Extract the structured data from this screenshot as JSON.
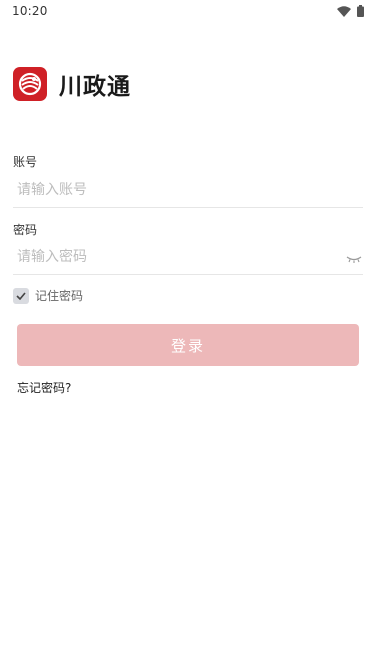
{
  "status_bar": {
    "time": "10:20",
    "icons": [
      "wifi-icon",
      "battery-icon"
    ]
  },
  "brand": {
    "app_name": "川政通",
    "logo_icon": "app-logo-icon",
    "logo_color": "#cf2026"
  },
  "login_form": {
    "account": {
      "label": "账号",
      "placeholder": "请输入账号",
      "value": ""
    },
    "password": {
      "label": "密码",
      "placeholder": "请输入密码",
      "value": "",
      "toggle_icon": "eye-closed-icon"
    },
    "remember": {
      "label": "记住密码",
      "checked": true
    },
    "login_button_label": "登录",
    "forgot_password_label": "忘记密码?"
  },
  "colors": {
    "accent": "#cf2026",
    "button_disabled_bg": "#edb8b9",
    "placeholder": "#bdbdbd",
    "divider": "#e6e6e6"
  }
}
